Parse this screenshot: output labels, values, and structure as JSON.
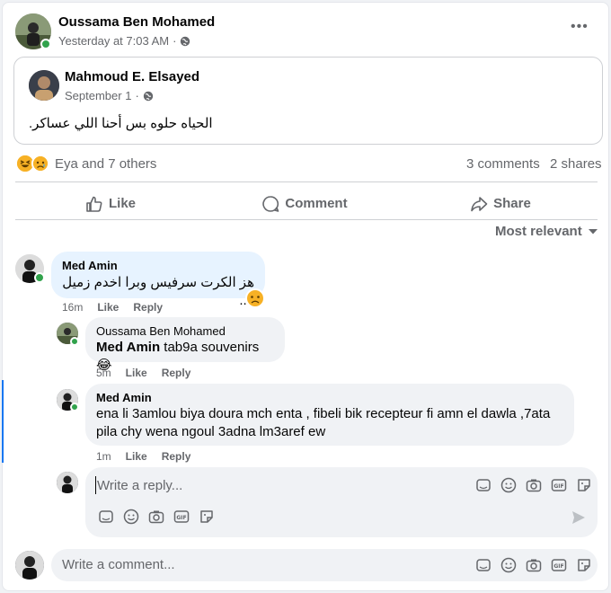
{
  "post": {
    "author": "Oussama Ben Mohamed",
    "time": "Yesterday at 7:03 AM",
    "privacy_sep": "·",
    "menu_label": "•••"
  },
  "shared_post": {
    "author": "Mahmoud E. Elsayed",
    "time": "September 1",
    "privacy_sep": "·",
    "text": "الحياه حلوه بس أحنا اللي عساكر."
  },
  "stats": {
    "reactions_text": "Eya and 7 others",
    "comments": "3 comments",
    "shares": "2 shares"
  },
  "actions": {
    "like": "Like",
    "comment": "Comment",
    "share": "Share"
  },
  "sort": {
    "label": "Most relevant"
  },
  "comments": [
    {
      "author": "Med Amin",
      "text": "هز الكرت سرفيس وبرا اخدم زميل ....",
      "time": "16m",
      "like": "Like",
      "reply": "Reply"
    }
  ],
  "replies": [
    {
      "author": "Oussama Ben Mohamed",
      "mention": "Med Amin",
      "text": " tab9a souvenirs 😂",
      "time": "5m",
      "like": "Like",
      "reply": "Reply"
    },
    {
      "author": "Med Amin",
      "line1": "ena li 3amlou biya doura mch enta , fibeli bik recepteur fi amn el dawla ,7ata",
      "line2": "pila chy wena ngoul 3adna lm3aref ew",
      "time": "1m",
      "like": "Like",
      "reply": "Reply"
    }
  ],
  "reply_box": {
    "placeholder": "Write a reply..."
  },
  "comment_box": {
    "placeholder": "Write a comment..."
  },
  "colors": {
    "accent": "#1877f2",
    "online": "#31a24c",
    "muted": "#65676b"
  },
  "icons": [
    "globe-icon",
    "like-icon",
    "comment-icon",
    "share-icon",
    "caret-down-icon",
    "avatar-sticker-icon",
    "emoji-icon",
    "camera-icon",
    "gif-icon",
    "sticker-icon",
    "send-icon",
    "haha-reaction-icon",
    "sad-reaction-icon"
  ]
}
